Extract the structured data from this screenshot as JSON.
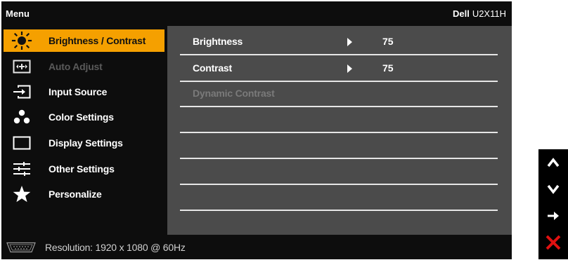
{
  "header": {
    "menu_title": "Menu",
    "brand": "Dell",
    "model": "U2X11H"
  },
  "sidebar": {
    "items": [
      {
        "label": "Brightness / Contrast",
        "icon": "brightness-icon",
        "state": "selected"
      },
      {
        "label": "Auto Adjust",
        "icon": "auto-adjust-icon",
        "state": "disabled"
      },
      {
        "label": "Input Source",
        "icon": "input-source-icon",
        "state": "normal"
      },
      {
        "label": "Color Settings",
        "icon": "color-settings-icon",
        "state": "normal"
      },
      {
        "label": "Display Settings",
        "icon": "display-settings-icon",
        "state": "normal"
      },
      {
        "label": "Other Settings",
        "icon": "other-settings-icon",
        "state": "normal"
      },
      {
        "label": "Personalize",
        "icon": "star-icon",
        "state": "normal"
      }
    ]
  },
  "panel": {
    "rows": [
      {
        "label": "Brightness",
        "value": "75",
        "state": "normal"
      },
      {
        "label": "Contrast",
        "value": "75",
        "state": "normal"
      },
      {
        "label": "Dynamic Contrast",
        "value": "",
        "state": "disabled"
      },
      {
        "label": "",
        "value": ""
      },
      {
        "label": "",
        "value": ""
      },
      {
        "label": "",
        "value": ""
      },
      {
        "label": "",
        "value": ""
      }
    ]
  },
  "status": {
    "connector_icon": "vga-connector-icon",
    "resolution": "Resolution: 1920 x 1080 @ 60Hz"
  },
  "keys": [
    {
      "name": "up",
      "icon": "chevron-up-icon"
    },
    {
      "name": "down",
      "icon": "chevron-down-icon"
    },
    {
      "name": "enter",
      "icon": "arrow-right-icon"
    },
    {
      "name": "exit",
      "icon": "close-icon"
    }
  ],
  "colors": {
    "accent": "#f5a000",
    "exit_red": "#e01010",
    "panel_bg": "#4b4b4b"
  }
}
